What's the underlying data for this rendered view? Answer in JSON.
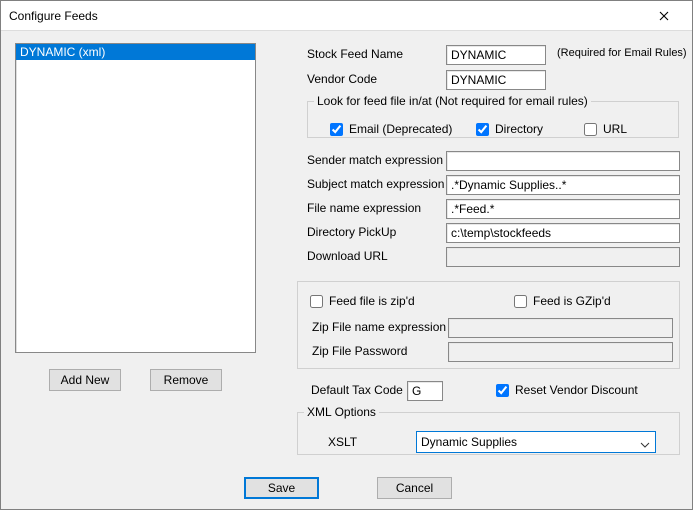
{
  "window": {
    "title": "Configure Feeds"
  },
  "list": {
    "items": [
      "DYNAMIC (xml)"
    ],
    "selected_index": 0
  },
  "buttons": {
    "add_new": "Add New",
    "remove": "Remove",
    "save": "Save",
    "cancel": "Cancel"
  },
  "labels": {
    "stock_feed_name": "Stock Feed Name",
    "vendor_code": "Vendor Code",
    "required_note": "(Required for Email Rules)",
    "look_group": "Look for feed file in/at (Not required for email rules)",
    "email_dep": "Email (Deprecated)",
    "directory": "Directory",
    "url": "URL",
    "sender_expr": "Sender match expression",
    "subject_expr": "Subject match expression",
    "file_expr": "File name expression",
    "dir_pickup": "Directory PickUp",
    "download_url": "Download URL",
    "feed_zip": "Feed file is zip'd",
    "feed_gzip": "Feed is GZip'd",
    "zip_file_expr": "Zip File name expression",
    "zip_pw": "Zip File Password",
    "default_tax": "Default Tax Code",
    "reset_vendor": "Reset Vendor Discount",
    "xml_options": "XML Options",
    "xslt": "XSLT"
  },
  "values": {
    "stock_feed_name": "DYNAMIC",
    "vendor_code": "DYNAMIC",
    "email_dep_checked": true,
    "directory_checked": true,
    "url_checked": false,
    "sender_expr": "",
    "subject_expr": ".*Dynamic Supplies..*",
    "file_expr": ".*Feed.*",
    "dir_pickup": "c:\\temp\\stockfeeds",
    "download_url": "",
    "feed_zip_checked": false,
    "feed_gzip_checked": false,
    "zip_file_expr": "",
    "zip_pw": "",
    "default_tax": "G",
    "reset_vendor_checked": true,
    "xslt": "Dynamic Supplies"
  }
}
